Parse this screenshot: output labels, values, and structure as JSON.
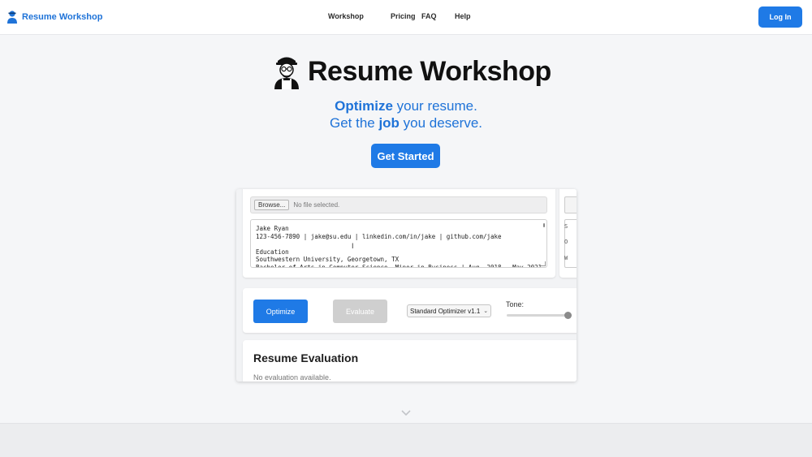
{
  "nav": {
    "brand": "Resume Workshop",
    "links": [
      "Workshop",
      "Pricing",
      "FAQ",
      "Help"
    ],
    "login_label": "Log In"
  },
  "hero": {
    "title": "Resume Workshop",
    "line1_bold": "Optimize",
    "line1_rest": " your resume.",
    "line2_pre": "Get the ",
    "line2_bold": "job",
    "line2_post": " you deserve.",
    "cta_label": "Get Started"
  },
  "demo": {
    "upload": {
      "browse_label": "Browse...",
      "file_status": "No file selected."
    },
    "resume_text": "Jake Ryan\n123-456-7890 | jake@su.edu | linkedin.com/in/jake | github.com/jake\n\nEducation\nSouthwestern University, Georgetown, TX\nBachelor of Arts in Computer Science, Minor in Business | Aug. 2018 – May 2021",
    "right_panel_fragments": [
      "S",
      "O",
      "W"
    ],
    "controls": {
      "optimize_label": "Optimize",
      "evaluate_label": "Evaluate",
      "optimizer_selected": "Standard Optimizer v1.1",
      "tone_label": "Tone:",
      "tone_value": 1.0
    },
    "evaluation": {
      "title": "Resume Evaluation",
      "empty_text": "No evaluation available."
    }
  },
  "colors": {
    "accent": "#1f7ae6",
    "brand_text": "#1f73d8",
    "disabled_button": "#cfcfcf"
  },
  "icons": {
    "brand": "person-icon",
    "hero": "worker-mascot-icon",
    "scroll_hint": "chevron-down-icon"
  }
}
